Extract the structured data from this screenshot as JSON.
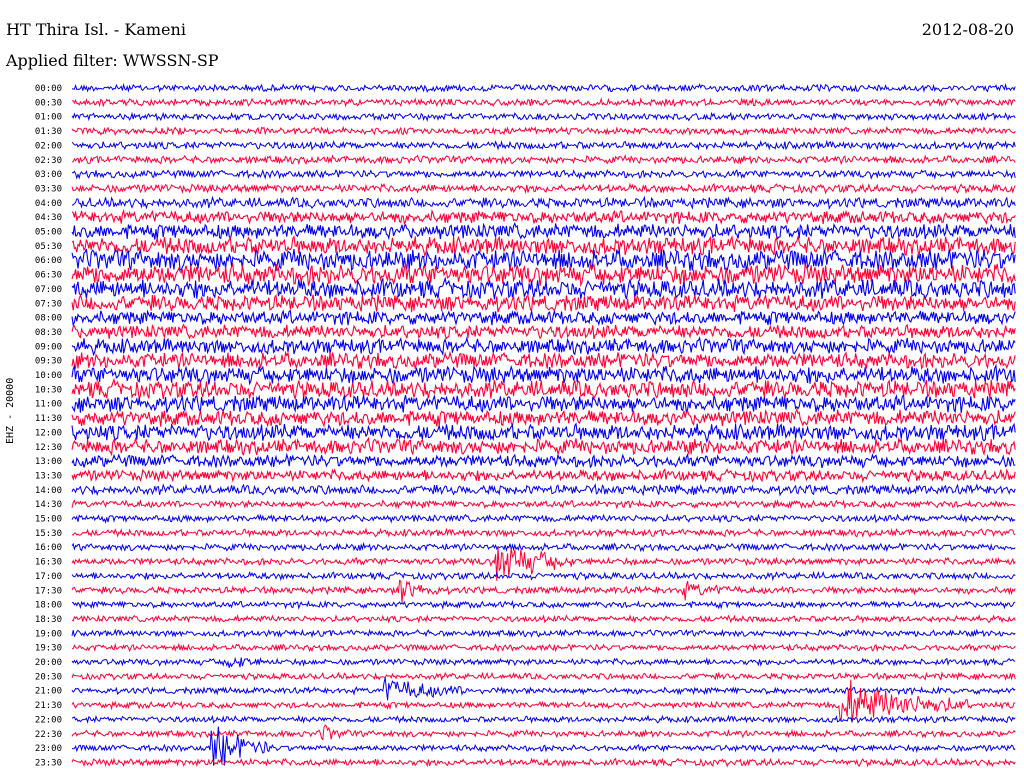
{
  "header": {
    "title": "HT Thira Isl. - Kameni",
    "date": "2012-08-20",
    "filter": "Applied filter: WWSSN-SP"
  },
  "channel_label": "EHZ - 20000",
  "colors": {
    "trace_a": "#0000ee",
    "trace_b": "#ff0033",
    "background": "#ffffff",
    "text": "#000000"
  },
  "chart_data": {
    "type": "line",
    "subtype": "helicorder",
    "title": "HT Thira Isl. - Kameni",
    "date": "2012-08-20",
    "ylabel": "EHZ - 20000",
    "time_labels": [
      "00:00",
      "00:30",
      "01:00",
      "01:30",
      "02:00",
      "02:30",
      "03:00",
      "03:30",
      "04:00",
      "04:30",
      "05:00",
      "05:30",
      "06:00",
      "06:30",
      "07:00",
      "07:30",
      "08:00",
      "08:30",
      "09:00",
      "09:30",
      "10:00",
      "10:30",
      "11:00",
      "11:30",
      "12:00",
      "12:30",
      "13:00",
      "13:30",
      "14:00",
      "14:30",
      "15:00",
      "15:30",
      "16:00",
      "16:30",
      "17:00",
      "17:30",
      "18:00",
      "18:30",
      "19:00",
      "19:30",
      "20:00",
      "20:30",
      "21:00",
      "21:30",
      "22:00",
      "22:30",
      "23:00",
      "23:30"
    ],
    "line_duration_minutes": 30,
    "series_colors": [
      "#0000ee",
      "#ff0033"
    ],
    "amplitude": [
      1.0,
      1.0,
      1.0,
      1.0,
      1.1,
      1.1,
      1.1,
      1.2,
      1.5,
      1.8,
      2.2,
      2.6,
      3.0,
      3.0,
      2.8,
      2.4,
      2.0,
      2.0,
      2.2,
      2.3,
      2.5,
      2.6,
      2.4,
      2.3,
      2.4,
      2.2,
      1.8,
      1.6,
      1.4,
      1.0,
      1.0,
      1.0,
      1.0,
      1.0,
      1.0,
      1.0,
      0.9,
      0.9,
      0.9,
      0.9,
      0.9,
      0.9,
      0.9,
      0.9,
      0.9,
      0.9,
      0.9,
      1.0
    ],
    "events": [
      {
        "line": "16:30",
        "minute": 13.5,
        "amplitude": 3.0,
        "duration": 1.2
      },
      {
        "line": "17:30",
        "minute": 10.5,
        "amplitude": 1.4,
        "duration": 0.6
      },
      {
        "line": "17:30",
        "minute": 19.5,
        "amplitude": 0.8,
        "duration": 0.8
      },
      {
        "line": "20:00",
        "minute": 5.0,
        "amplitude": 0.9,
        "duration": 0.5
      },
      {
        "line": "21:00",
        "minute": 10.0,
        "amplitude": 1.5,
        "duration": 1.3
      },
      {
        "line": "21:30",
        "minute": 24.5,
        "amplitude": 3.2,
        "duration": 2.0
      },
      {
        "line": "22:30",
        "minute": 8.0,
        "amplitude": 0.9,
        "duration": 0.4
      },
      {
        "line": "23:00",
        "minute": 4.5,
        "amplitude": 3.0,
        "duration": 0.9
      }
    ]
  }
}
